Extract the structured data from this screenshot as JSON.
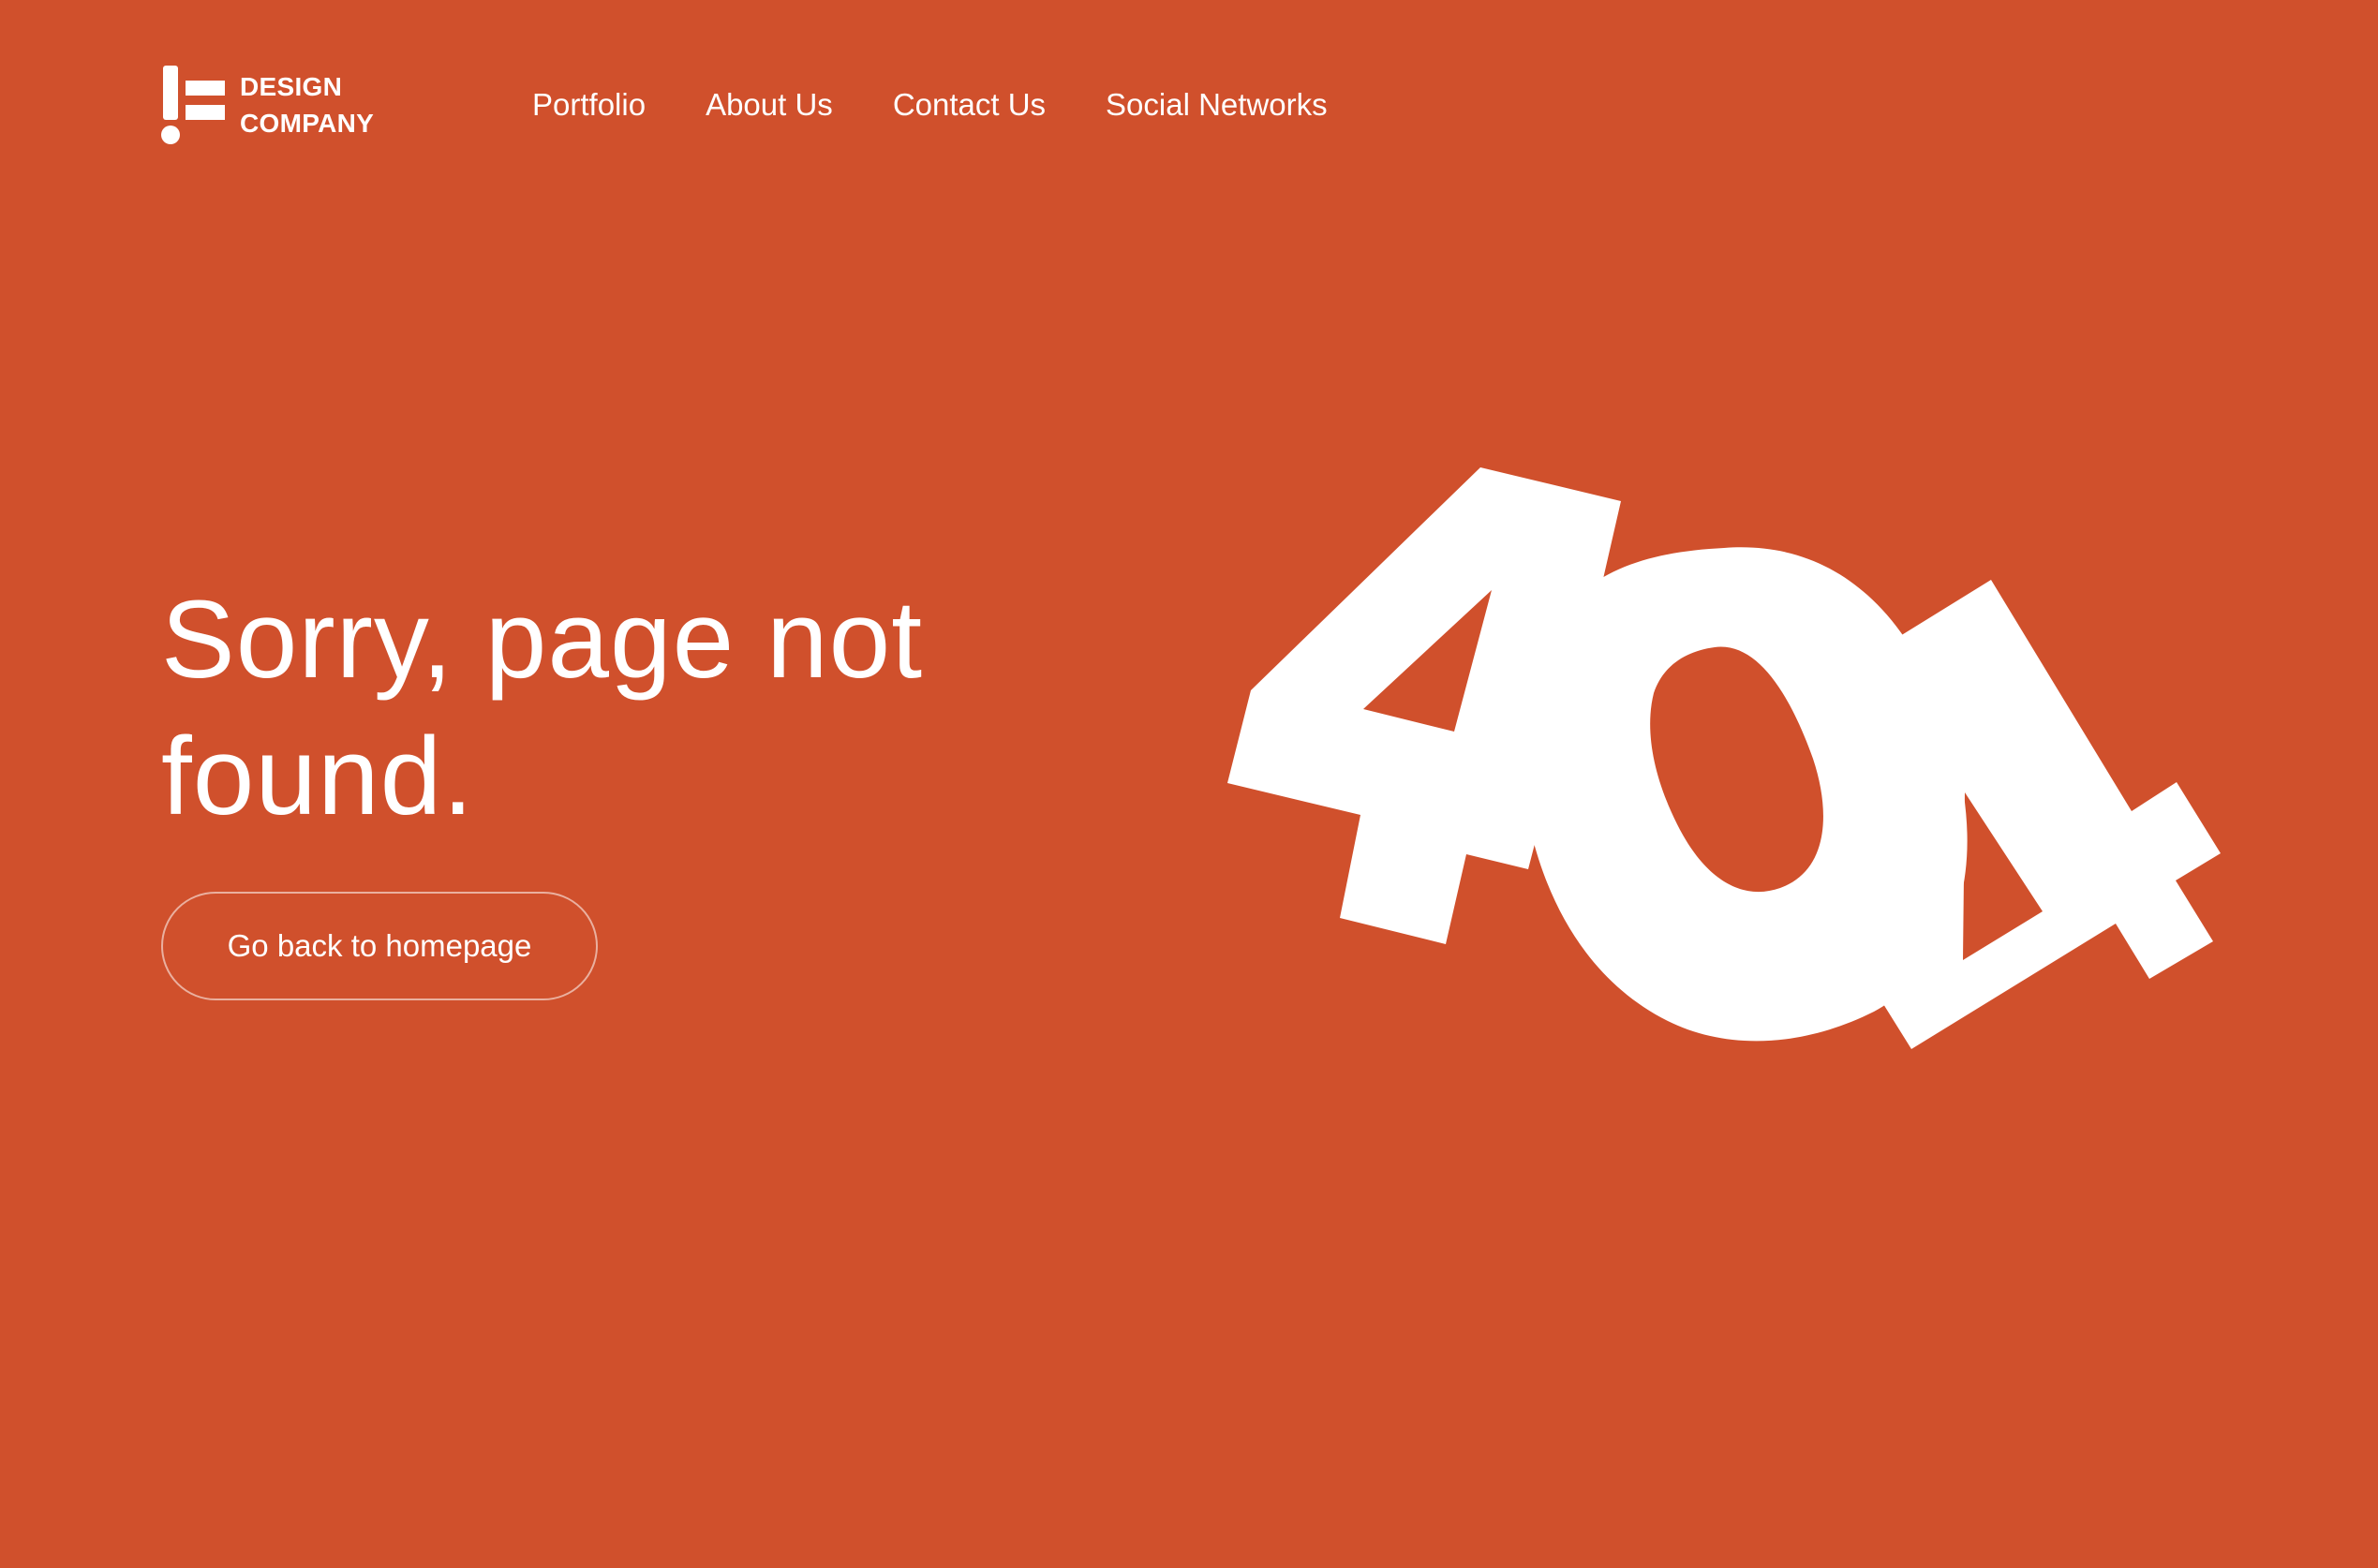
{
  "brand": {
    "line1": "DESIGN",
    "line2": "COMPANY"
  },
  "nav": {
    "items": [
      "Portfolio",
      "About Us",
      "Contact Us",
      "Social Networks"
    ]
  },
  "hero": {
    "headline": "Sorry, page not found.",
    "button_label": "Go back to homepage",
    "art_text": "404"
  },
  "colors": {
    "background": "#d0502c",
    "foreground": "#ffffff"
  },
  "icons": {
    "logo": "exclamation-bars-logo"
  }
}
